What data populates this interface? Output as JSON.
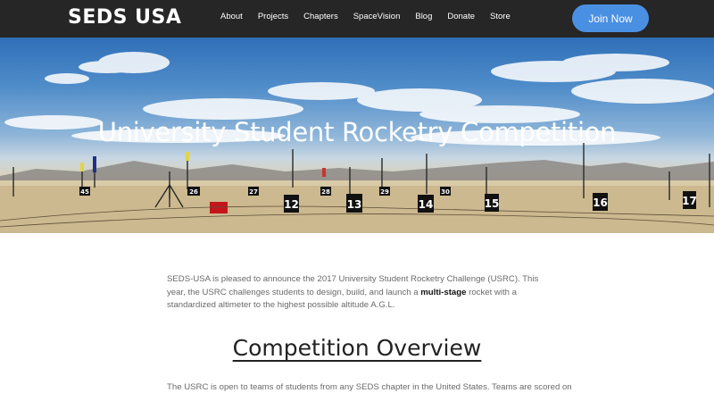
{
  "nav": {
    "logo": "SEDS USA",
    "items": [
      {
        "label": "About"
      },
      {
        "label": "Projects"
      },
      {
        "label": "Chapters"
      },
      {
        "label": "SpaceVision"
      },
      {
        "label": "Blog"
      },
      {
        "label": "Donate"
      },
      {
        "label": "Store"
      }
    ],
    "join_label": "Join Now",
    "join_color": "#4a90e2"
  },
  "hero": {
    "title": "University Student Rocketry Competition",
    "pad_numbers": [
      "45",
      "26",
      "27",
      "28",
      "12",
      "13",
      "29",
      "14",
      "30",
      "15",
      "16",
      "17"
    ]
  },
  "intro": {
    "before_bold": "SEDS-USA is pleased to announce the 2017 University Student Rocketry Challenge (USRC). This year, the USRC challenges students to design, build, and launch a ",
    "bold": "multi-stage",
    "after_bold": " rocket with a standardized altimeter to the highest possible altitude A.G.L."
  },
  "overview": {
    "heading": "Competition Overview",
    "text": "The USRC is open to teams of students from any SEDS chapter in the United States. Teams are scored on"
  }
}
